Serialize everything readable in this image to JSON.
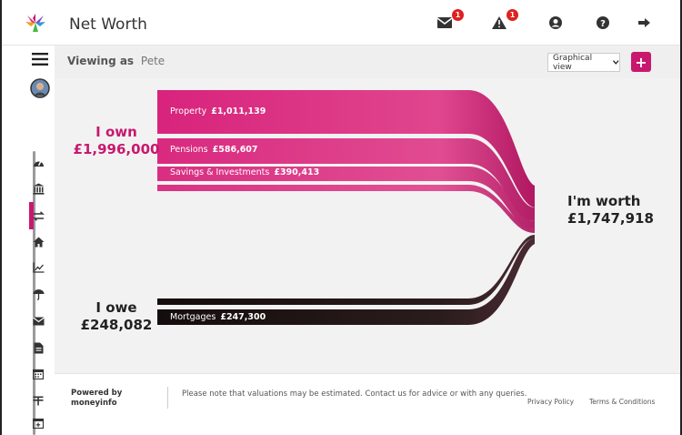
{
  "app": {
    "title": "Net Worth"
  },
  "topbar": {
    "messages_count": "1",
    "alerts_count": "1"
  },
  "subheader": {
    "viewing_label": "Viewing as",
    "viewing_name": "Pete",
    "view_select_value": "Graphical view",
    "add_label": "+"
  },
  "sankey": {
    "own_label": "I own",
    "own_value": "£1,996,000",
    "owe_label": "I owe",
    "owe_value": "£248,082",
    "worth_label": "I'm worth",
    "worth_value": "£1,747,918",
    "assets": [
      {
        "name": "Property",
        "value": "£1,011,139"
      },
      {
        "name": "Pensions",
        "value": "£586,607"
      },
      {
        "name": "Savings & Investments",
        "value": "£390,413"
      }
    ],
    "liabilities": [
      {
        "name": "Mortgages",
        "value": "£247,300"
      }
    ]
  },
  "footer": {
    "powered_line1": "Powered by",
    "powered_line2": "moneyinfo",
    "disclaimer": "Please note that valuations may be estimated. Contact us for advice or with any queries.",
    "privacy": "Privacy Policy",
    "terms": "Terms & Conditions"
  },
  "colors": {
    "accent": "#c8186e",
    "asset_flow": "#d8237c",
    "liability_flow": "#1a1212"
  }
}
